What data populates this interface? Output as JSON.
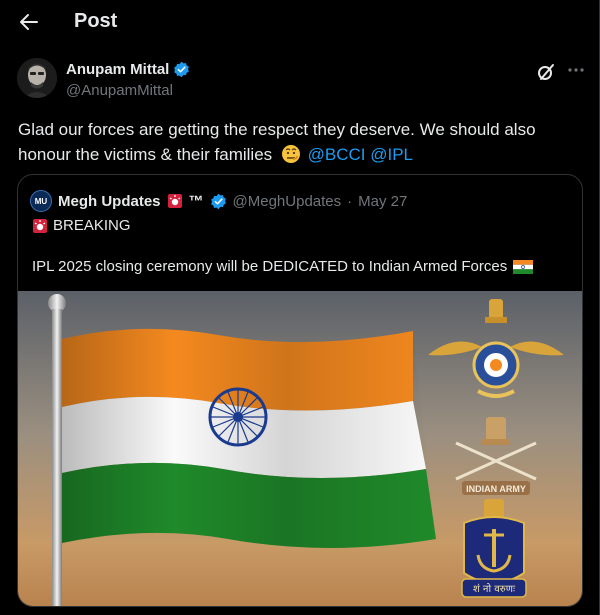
{
  "header": {
    "title": "Post"
  },
  "post": {
    "author_name": "Anupam Mittal",
    "author_handle": "@AnupamMittal",
    "text": "Glad our forces are getting the respect they deserve. We should also honour the victims & their families",
    "mentions": [
      "@BCCI",
      "@IPL"
    ]
  },
  "quote": {
    "author_name": "Megh Updates",
    "author_suffix": "™",
    "author_handle": "@MeghUpdates",
    "date": "May 27",
    "breaking": "BREAKING",
    "text": "IPL 2025 closing ceremony will be DEDICATED to Indian Armed Forces",
    "image": {
      "army_label": "INDIAN ARMY",
      "navy_motto": "शं नो वरुणः"
    }
  },
  "colors": {
    "background": "#000000",
    "accent": "#1d9bf0",
    "muted": "#71767b",
    "saffron": "#f4891f",
    "green": "#1f8a2a",
    "chakra": "#1a3a8f"
  }
}
